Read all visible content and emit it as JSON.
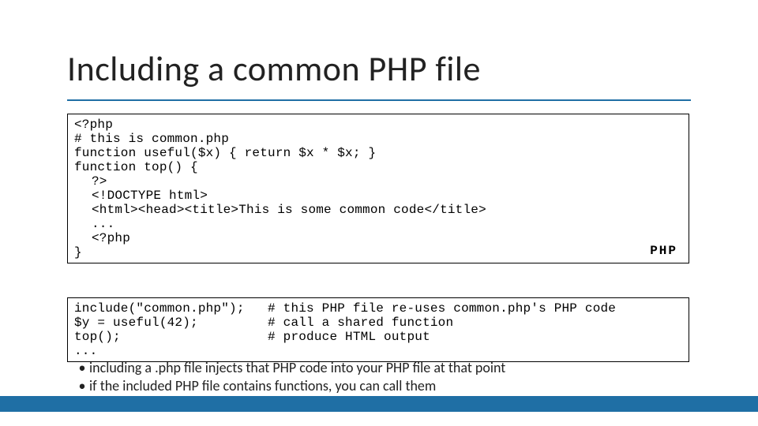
{
  "title": "Including a common PHP file",
  "code_block_1": {
    "line1": "<?php",
    "line2": "# this is common.php",
    "line3": "function useful($x) { return $x * $x; }",
    "line4": "function top() {",
    "inner1": "?>",
    "inner2": "<!DOCTYPE html>",
    "inner3": "<html><head><title>This is some common code</title>",
    "inner4": "...",
    "inner5": "<?php",
    "close": "}",
    "label": "PHP"
  },
  "code_block_2": {
    "line1": "include(\"common.php\");   # this PHP file re-uses common.php's PHP code",
    "line2": "$y = useful(42);         # call a shared function",
    "line3": "top();                   # produce HTML output",
    "line4": "..."
  },
  "bullets": {
    "b1": " including a .php file injects that PHP code into your PHP file at that point",
    "b2": "if the included PHP file contains functions, you can call them"
  }
}
